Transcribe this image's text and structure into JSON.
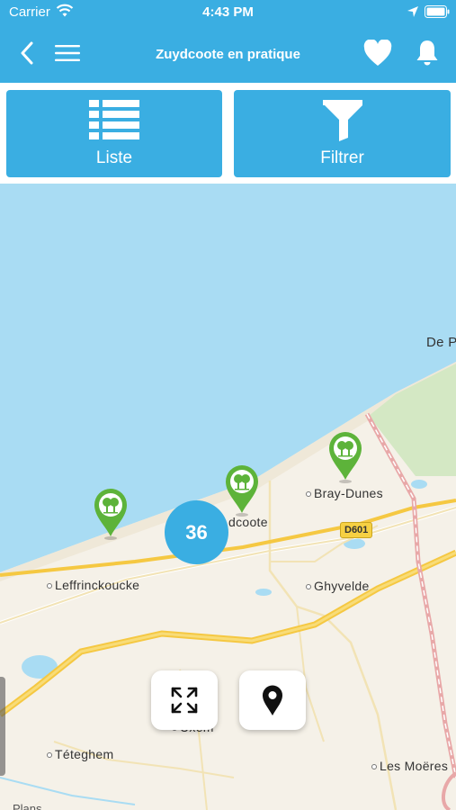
{
  "status_bar": {
    "carrier": "Carrier",
    "time": "4:43 PM"
  },
  "header": {
    "title": "Zuydcoote en pratique"
  },
  "toolbar": {
    "list_label": "Liste",
    "filter_label": "Filtrer"
  },
  "map": {
    "places": {
      "de_panne": "De P",
      "bray_dunes": "Bray-Dunes",
      "zuydcoote": "dcoote",
      "leffrinckoucke": "Leffrinckoucke",
      "ghyvelde": "Ghyvelde",
      "teteghem": "Téteghem",
      "uxem": "Uxem",
      "les_moeres": "Les Moëres"
    },
    "road_label": "D601",
    "cluster_count": "36",
    "attribution": "Plans"
  },
  "colors": {
    "accent": "#3aaee2",
    "marker_green": "#5db33a",
    "sea": "#a9dcf3",
    "land": "#f5f1e8",
    "road_yellow": "#f5c842"
  },
  "icons": [
    "wifi-icon",
    "location-arrow-icon",
    "battery-icon",
    "back-chevron-icon",
    "hamburger-menu-icon",
    "heart-icon",
    "bell-icon",
    "list-icon",
    "filter-icon",
    "expand-icon",
    "location-pin-icon",
    "tree-marker-icon"
  ]
}
